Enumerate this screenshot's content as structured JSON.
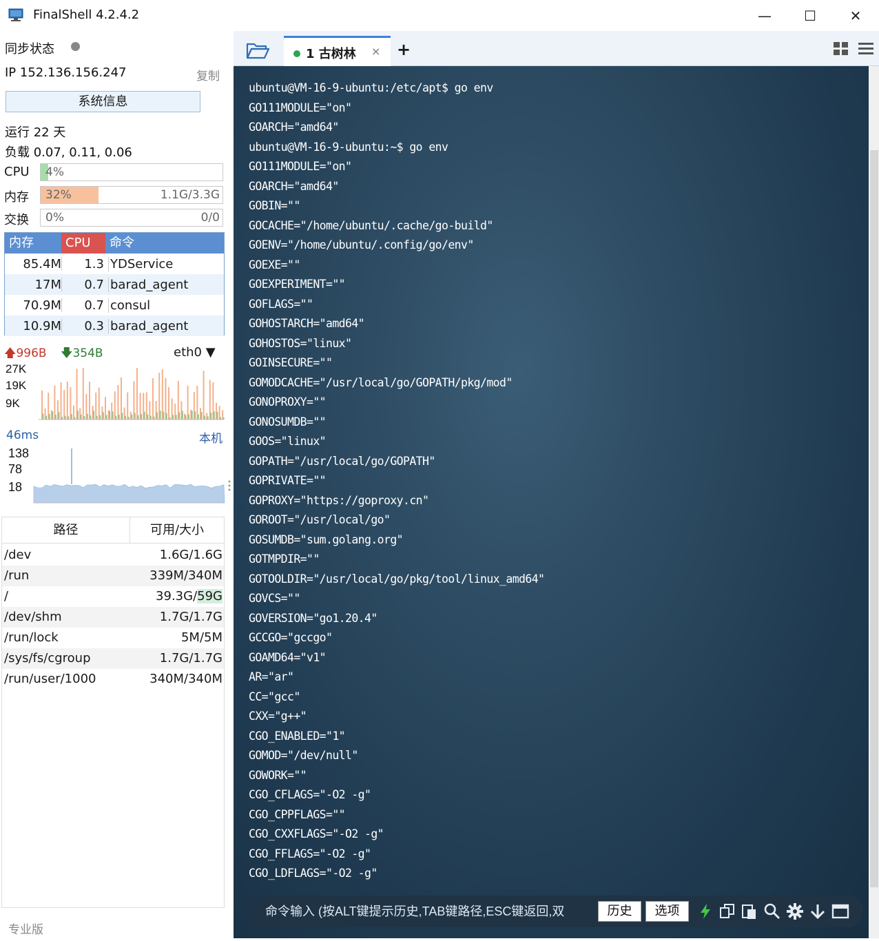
{
  "window": {
    "title": "FinalShell 4.2.4.2",
    "buttons": {
      "minimize": "—",
      "maximize": "☐",
      "close": "✕"
    }
  },
  "status": {
    "sync_label": "同步状态",
    "ip_label": "IP  152.136.156.247",
    "copy_label": "复制",
    "sysinfo_label": "系统信息",
    "uptime": "运行 22 天",
    "load": "负载 0.07, 0.11, 0.06"
  },
  "meters": {
    "cpu": {
      "label": "CPU",
      "pct_text": "4%",
      "fraction": 0.04,
      "right": "",
      "color": "#a8dca8"
    },
    "mem": {
      "label": "内存",
      "pct_text": "32%",
      "fraction": 0.32,
      "right": "1.1G/3.3G",
      "color": "#f7c19e"
    },
    "swap": {
      "label": "交换",
      "pct_text": "0%",
      "fraction": 0.0,
      "right": "0/0",
      "color": "#cccccc"
    }
  },
  "processes": {
    "headers": {
      "mem": "内存",
      "cpu": "CPU",
      "cmd": "命令"
    },
    "rows": [
      {
        "mem": "85.4M",
        "cpu": "1.3",
        "cmd": "YDService"
      },
      {
        "mem": "17M",
        "cpu": "0.7",
        "cmd": "barad_agent"
      },
      {
        "mem": "70.9M",
        "cpu": "0.7",
        "cmd": "consul"
      },
      {
        "mem": "10.9M",
        "cpu": "0.3",
        "cmd": "barad_agent"
      }
    ]
  },
  "network": {
    "up": "996B",
    "down": "354B",
    "interface": "eth0",
    "y_ticks": [
      "27K",
      "19K",
      "9K"
    ],
    "upload_color": "#f5b08a",
    "download_color": "#9fbf8a"
  },
  "latency": {
    "current": "46ms",
    "host": "本机",
    "y_ticks": [
      "138",
      "78",
      "18"
    ],
    "fill_color": "#b7cfe9"
  },
  "disks": {
    "headers": {
      "path": "路径",
      "size": "可用/大小"
    },
    "rows": [
      {
        "path": "/dev",
        "size": "1.6G/1.6G"
      },
      {
        "path": "/run",
        "size": "339M/340M"
      },
      {
        "path": "/",
        "size_a": "39.3G/",
        "size_b": "59G"
      },
      {
        "path": "/dev/shm",
        "size": "1.7G/1.7G"
      },
      {
        "path": "/run/lock",
        "size": "5M/5M"
      },
      {
        "path": "/sys/fs/cgroup",
        "size": "1.7G/1.7G"
      },
      {
        "path": "/run/user/1000",
        "size": "340M/340M"
      }
    ]
  },
  "edition": "专业版",
  "tabs": [
    {
      "label": "1 古树林",
      "active": true
    }
  ],
  "tab_close": "×",
  "tab_add": "+",
  "terminal": {
    "lines": [
      "ubuntu@VM-16-9-ubuntu:/etc/apt$ go env",
      "GO111MODULE=\"on\"",
      "GOARCH=\"amd64\"",
      "ubuntu@VM-16-9-ubuntu:~$ go env",
      "GO111MODULE=\"on\"",
      "GOARCH=\"amd64\"",
      "GOBIN=\"\"",
      "GOCACHE=\"/home/ubuntu/.cache/go-build\"",
      "GOENV=\"/home/ubuntu/.config/go/env\"",
      "GOEXE=\"\"",
      "GOEXPERIMENT=\"\"",
      "GOFLAGS=\"\"",
      "GOHOSTARCH=\"amd64\"",
      "GOHOSTOS=\"linux\"",
      "GOINSECURE=\"\"",
      "GOMODCACHE=\"/usr/local/go/GOPATH/pkg/mod\"",
      "GONOPROXY=\"\"",
      "GONOSUMDB=\"\"",
      "GOOS=\"linux\"",
      "GOPATH=\"/usr/local/go/GOPATH\"",
      "GOPRIVATE=\"\"",
      "GOPROXY=\"https://goproxy.cn\"",
      "GOROOT=\"/usr/local/go\"",
      "GOSUMDB=\"sum.golang.org\"",
      "GOTMPDIR=\"\"",
      "GOTOOLDIR=\"/usr/local/go/pkg/tool/linux_amd64\"",
      "GOVCS=\"\"",
      "GOVERSION=\"go1.20.4\"",
      "GCCGO=\"gccgo\"",
      "GOAMD64=\"v1\"",
      "AR=\"ar\"",
      "CC=\"gcc\"",
      "CXX=\"g++\"",
      "CGO_ENABLED=\"1\"",
      "GOMOD=\"/dev/null\"",
      "GOWORK=\"\"",
      "CGO_CFLAGS=\"-O2 -g\"",
      "CGO_CPPFLAGS=\"\"",
      "CGO_CXXFLAGS=\"-O2 -g\"",
      "CGO_FFLAGS=\"-O2 -g\"",
      "CGO_LDFLAGS=\"-O2 -g\""
    ]
  },
  "command_bar": {
    "placeholder": "命令输入 (按ALT键提示历史,TAB键路径,ESC键返回,双",
    "history_label": "历史",
    "options_label": "选项"
  }
}
